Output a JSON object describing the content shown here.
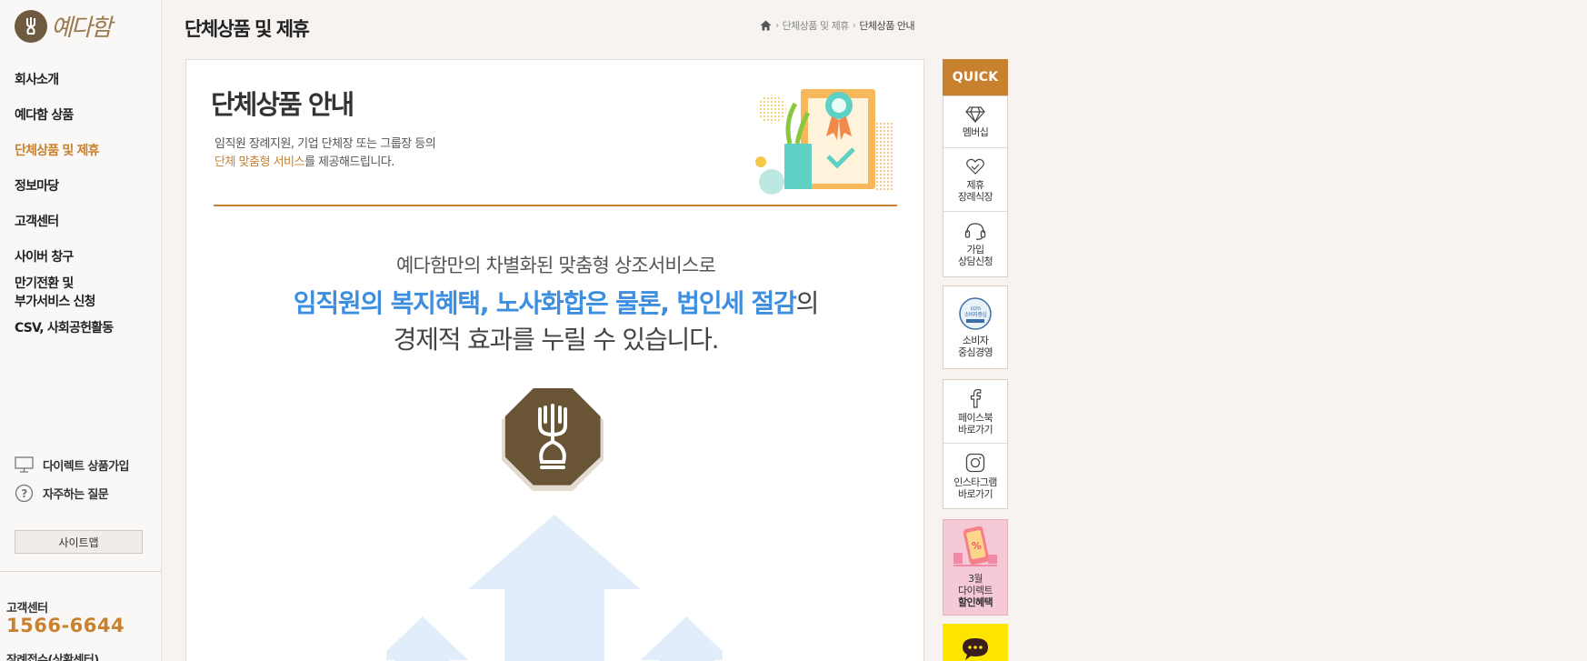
{
  "brand": {
    "logo_text": "예다함"
  },
  "nav": {
    "items": [
      {
        "label": "회사소개",
        "active": false
      },
      {
        "label": "예다함 상품",
        "active": false
      },
      {
        "label": "단체상품 및 제휴",
        "active": true
      },
      {
        "label": "정보마당",
        "active": false
      },
      {
        "label": "고객센터",
        "active": false
      },
      {
        "label": "사이버 창구",
        "active": false
      },
      {
        "label": "만기전환 및",
        "active": false
      },
      {
        "label": "부가서비스 신청",
        "active": false
      },
      {
        "label": "CSV, 사회공헌활동",
        "active": false
      }
    ]
  },
  "side_links": {
    "direct_signup": "다이렉트 상품가입",
    "faq": "자주하는 질문",
    "sitemap": "사이트맵"
  },
  "customer_center": {
    "title": "고객센터",
    "phone": "1566-6644",
    "sub": "장례접수(상황센터)"
  },
  "header": {
    "page_title": "단체상품 및 제휴",
    "breadcrumb": [
      "단체상품 및 제휴",
      "단체상품 안내"
    ]
  },
  "content": {
    "title": "단체상품 안내",
    "desc_line1": "임직원 장례지원, 기업 단체장 또는 그룹장 등의",
    "desc_highlight": "단체 맞춤형 서비스",
    "desc_line2_rest": "를 제공해드립니다.",
    "lead_line1": "예다함만의 차별화된 맞춤형 상조서비스로",
    "lead_blue": "임직원의 복지혜택, 노사화합은 물론, 법인세 절감",
    "lead_suffix": "의",
    "lead_line3": "경제적 효과를 누릴 수 있습니다."
  },
  "quick_menu": {
    "header": "QUICK",
    "membership": "멤버십",
    "partner_l1": "제휴",
    "partner_l2": "장례식장",
    "consult_l1": "가입",
    "consult_l2": "상담신청",
    "ccm_badge": "소비자중심",
    "ccm_l1": "소비자",
    "ccm_l2": "중심경영",
    "facebook_l1": "페이스북",
    "facebook_l2": "바로가기",
    "instagram_l1": "인스타그램",
    "instagram_l2": "바로가기",
    "promo_l1": "3월",
    "promo_l2": "다이렉트",
    "promo_l3": "할인혜택"
  },
  "colors": {
    "accent": "#c8812f",
    "blue": "#3e8ee0",
    "kakao": "#fde500",
    "promo_bg": "#f5c9d6"
  }
}
